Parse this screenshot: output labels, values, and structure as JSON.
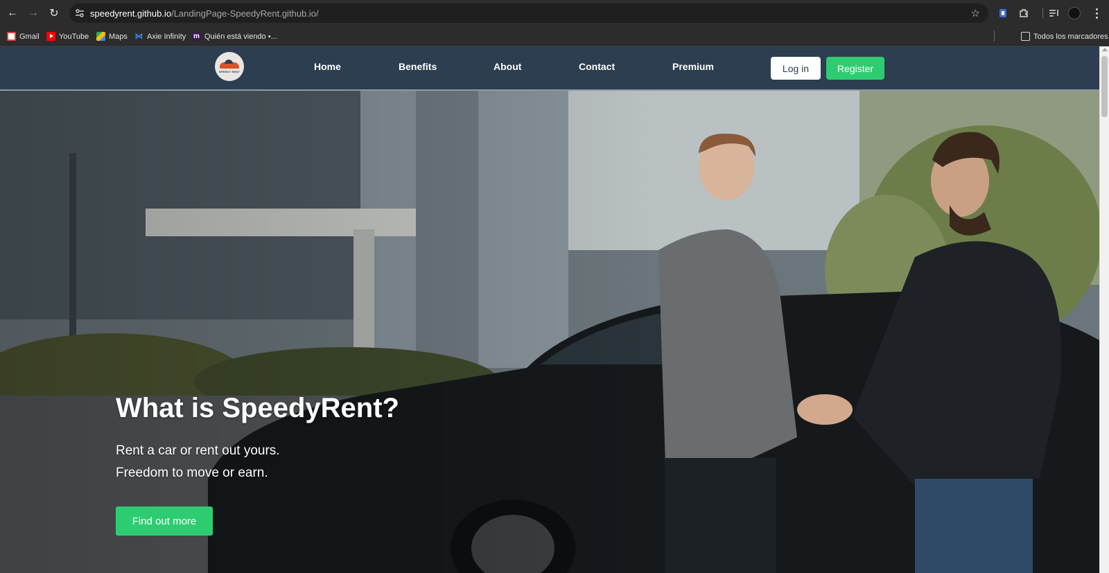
{
  "browser": {
    "url_host": "speedyrent.github.io",
    "url_path": "/LandingPage-SpeedyRent.github.io/",
    "bookmarks": [
      {
        "label": "Gmail",
        "icon": "gmail-icon"
      },
      {
        "label": "YouTube",
        "icon": "youtube-icon"
      },
      {
        "label": "Maps",
        "icon": "maps-icon"
      },
      {
        "label": "Axie Infinity",
        "icon": "axie-icon"
      },
      {
        "label": "Quién está viendo •...",
        "icon": "quien-icon"
      }
    ],
    "all_bookmarks_label": "Todos los marcadores"
  },
  "site": {
    "logo_text": "SPEEDY RENT",
    "nav": [
      "Home",
      "Benefits",
      "About",
      "Contact",
      "Premium"
    ],
    "login_label": "Log in",
    "register_label": "Register",
    "colors": {
      "header": "#2c3e50",
      "accent": "#2ecc71"
    }
  },
  "hero": {
    "title": "What is SpeedyRent?",
    "line1": "Rent a car or rent out yours.",
    "line2": "Freedom to move or earn.",
    "cta_label": "Find out more"
  }
}
